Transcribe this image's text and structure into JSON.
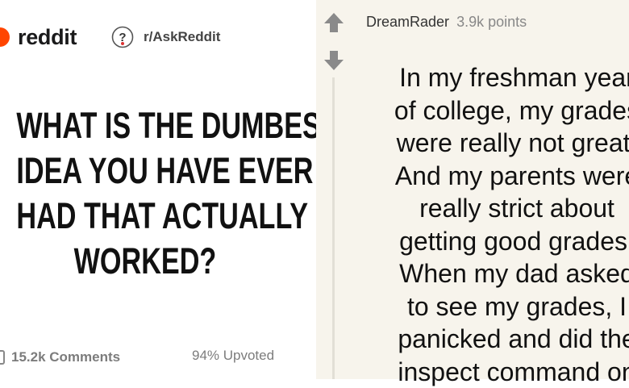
{
  "header": {
    "brand": "reddit",
    "subreddit": "r/AskReddit"
  },
  "post": {
    "title_lines": [
      "WHAT IS THE DUMBEST",
      "IDEA YOU HAVE EVER",
      "HAD THAT ACTUALLY",
      "WORKED?"
    ],
    "comments": "15.2k Comments",
    "upvoted": "94% Upvoted"
  },
  "comment": {
    "author": "DreamRader",
    "points": "3.9k points",
    "lines": [
      "In my freshman year",
      "of college, my grades",
      "were really not great.",
      "And my parents were",
      "really strict about",
      "getting good grades.",
      "When my dad asked",
      "to see my grades, I",
      "panicked and did the",
      "inspect command on"
    ]
  },
  "colors": {
    "brand": "#ff4500",
    "vote_arrow": "#8a8a8a",
    "muted_text": "#7c7c7c",
    "right_panel_bg": "#f7f4ec"
  },
  "icons": [
    "reddit-logo-icon",
    "askreddit-icon",
    "comment-icon",
    "upvote-arrow-icon",
    "downvote-arrow-icon"
  ]
}
